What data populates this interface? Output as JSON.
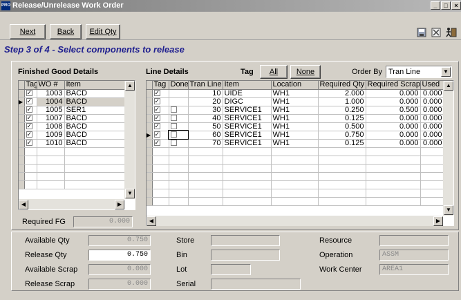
{
  "window": {
    "title": "Release/Unrelease Work Order",
    "icon": "PRO",
    "min": "_",
    "max": "□",
    "close": "×"
  },
  "toolbar": {
    "next": "Next",
    "back": "Back",
    "edit_qty": "Edit Qty",
    "icons": [
      "save-icon",
      "clear-icon",
      "exit-icon"
    ]
  },
  "step_title": "Step 3 of 4 - Select components to release",
  "fg": {
    "title": "Finished Good Details",
    "columns": [
      "Tag",
      "WO #",
      "Item"
    ],
    "rows": [
      {
        "tag": true,
        "wo": "1003",
        "item": "BACD"
      },
      {
        "tag": true,
        "wo": "1004",
        "item": "BACD"
      },
      {
        "tag": true,
        "wo": "1005",
        "item": "SER1"
      },
      {
        "tag": true,
        "wo": "1007",
        "item": "BACD"
      },
      {
        "tag": true,
        "wo": "1008",
        "item": "BACD"
      },
      {
        "tag": true,
        "wo": "1009",
        "item": "BACD"
      },
      {
        "tag": true,
        "wo": "1010",
        "item": "BACD"
      }
    ],
    "required_fg_label": "Required FG",
    "required_fg_value": "0.000"
  },
  "line": {
    "title": "Line Details",
    "tag_label": "Tag",
    "all_button": "All",
    "none_button": "None",
    "order_by_label": "Order By",
    "order_by_value": "Tran Line",
    "columns": [
      "Tag",
      "Done",
      "Tran Line",
      "Item",
      "Location",
      "Required Qty",
      "Required Scrap",
      "Used"
    ],
    "rows": [
      {
        "tag": true,
        "done": null,
        "line": "10",
        "item": "UIDE",
        "loc": "WH1",
        "qty": "2.000",
        "scrap": "0.000",
        "used": "0.000"
      },
      {
        "tag": true,
        "done": null,
        "line": "20",
        "item": "DIGC",
        "loc": "WH1",
        "qty": "1.000",
        "scrap": "0.000",
        "used": "0.000"
      },
      {
        "tag": true,
        "done": false,
        "line": "30",
        "item": "SERVICE1",
        "loc": "WH1",
        "qty": "0.250",
        "scrap": "0.500",
        "used": "0.000"
      },
      {
        "tag": true,
        "done": false,
        "line": "40",
        "item": "SERVICE1",
        "loc": "WH1",
        "qty": "0.125",
        "scrap": "0.000",
        "used": "0.000"
      },
      {
        "tag": true,
        "done": false,
        "line": "50",
        "item": "SERVICE1",
        "loc": "WH1",
        "qty": "0.500",
        "scrap": "0.000",
        "used": "0.000"
      },
      {
        "tag": true,
        "done": false,
        "line": "60",
        "item": "SERVICE1",
        "loc": "WH1",
        "qty": "0.750",
        "scrap": "0.000",
        "used": "0.000"
      },
      {
        "tag": true,
        "done": false,
        "line": "70",
        "item": "SERVICE1",
        "loc": "WH1",
        "qty": "0.125",
        "scrap": "0.000",
        "used": "0.000"
      }
    ]
  },
  "details": {
    "available_qty_label": "Available Qty",
    "available_qty": "0.750",
    "release_qty_label": "Release Qty",
    "release_qty": "0.750",
    "available_scrap_label": "Available Scrap",
    "available_scrap": "0.000",
    "release_scrap_label": "Release Scrap",
    "release_scrap": "0.000",
    "store_label": "Store",
    "store": "",
    "bin_label": "Bin",
    "bin": "",
    "lot_label": "Lot",
    "lot": "",
    "serial_label": "Serial",
    "serial": "",
    "resource_label": "Resource",
    "resource": "",
    "operation_label": "Operation",
    "operation": "ASSM",
    "work_center_label": "Work Center",
    "work_center": "AREA1"
  }
}
